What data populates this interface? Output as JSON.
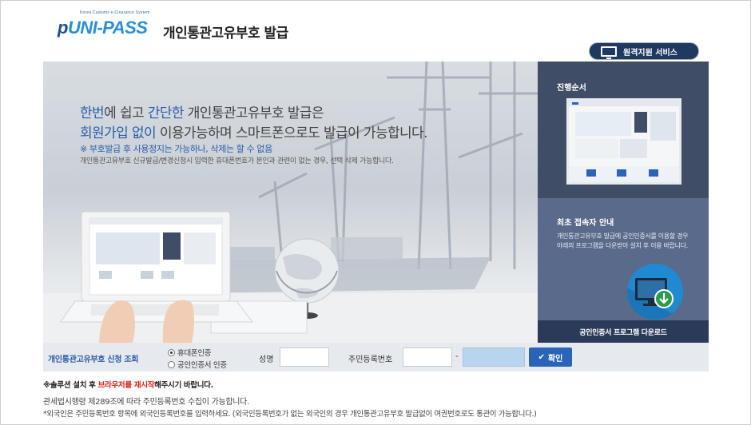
{
  "header": {
    "logo_sub": "Korea Customs e-Clearance System",
    "logo_prefix": "p",
    "logo_mid": "UNI-PASS",
    "title": "개인통관고유부호 발급",
    "remote_button": "원격지원 서비스"
  },
  "banner": {
    "line1_a": "한번",
    "line1_b": "에 쉽고 ",
    "line1_c": "간단한",
    "line1_d": " 개인통관고유부호 발급은",
    "line2_a": "회원가입 없이",
    "line2_b": " 이용가능하며 스마트폰으로도 발급이 가능합니다.",
    "note": "※ 부호발급 후 사용정지는 가능하나, 삭제는 할 수 없음",
    "desc": "개인통관고유부호 신규발급/변경신청시 입력한 휴대폰번호가 본인과 관련이 없는 경우, 선택 삭제 가능합니다."
  },
  "side": {
    "process_title": "진행순서",
    "first_title": "최초 접속자 안내",
    "first_desc": "개인통관고유부호 발급에 공인인증서를 이용할 경우 아래의 프로그램을 다운받아 설치 후 이용 바랍니다.",
    "download_label": "공인인증서 프로그램 다운로드"
  },
  "form": {
    "title": "개인통관고유부호 신청 조회",
    "radio_phone": "휴대폰인증",
    "radio_cert": "공인인증서 인증",
    "selected": "phone",
    "name_label": "성명",
    "name_value": "",
    "rrn_label": "주민등록번호",
    "rrn_front": "",
    "rrn_back": "",
    "dash": "-",
    "confirm": "확인"
  },
  "notices": {
    "n1_a": "※솔루션 설치 후 ",
    "n1_b": "브라우저를 재시작",
    "n1_c": "해주시기 바랍니다.",
    "n2": "관세법시행령 제289조에 따라 주민등록번호 수집이 가능합니다.",
    "n3": "*외국인은 주민등록번호 항목에 외국인등록번호를 입력하세요.   (외국인등록번호가 없는 외국인의 경우 개인통관고유부호 발급없이 여권번호로도 통관이 가능합니다.)"
  },
  "colors": {
    "brand_blue": "#2a5da8",
    "panel_dark": "#3f4d66",
    "panel_mid": "#5a6a8a",
    "warn_red": "#d9261c",
    "download_blue": "#1f8ad2"
  },
  "icons": [
    "monitor-icon",
    "check-icon",
    "download-monitor-icon",
    "globe-image",
    "laptop-image"
  ]
}
